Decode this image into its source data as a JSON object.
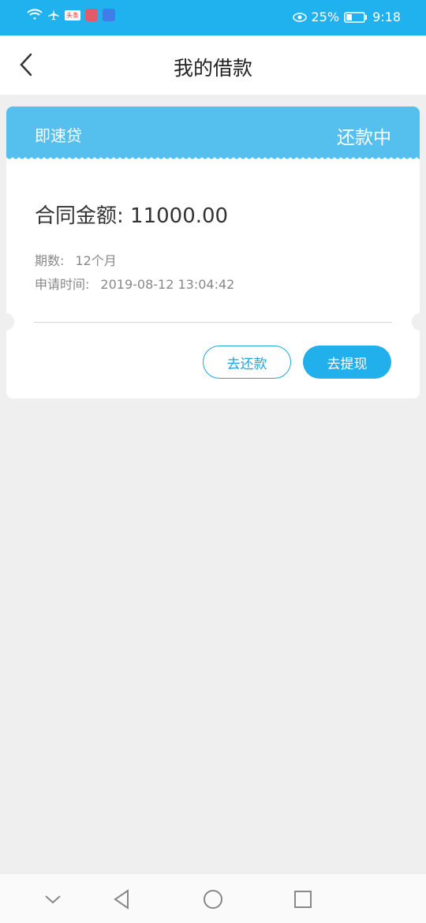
{
  "status_bar": {
    "battery_percent": "25%",
    "time": "9:18",
    "notif_badge_1": "头条",
    "color": "#20b2ee"
  },
  "header": {
    "title": "我的借款"
  },
  "loan_card": {
    "product_name": "即速贷",
    "status": "还款中",
    "amount_label": "合同金额:",
    "amount_value": "11000.00",
    "term_label": "期数:",
    "term_value": "12个月",
    "apply_time_label": "申请时间:",
    "apply_time_value": "2019-08-12 13:04:42",
    "repay_button": "去还款",
    "withdraw_button": "去提现",
    "header_color": "#55c0ee"
  },
  "bottom_nav": {
    "icons": [
      "chevron-down-icon",
      "back-triangle-icon",
      "home-circle-icon",
      "recent-square-icon"
    ]
  }
}
